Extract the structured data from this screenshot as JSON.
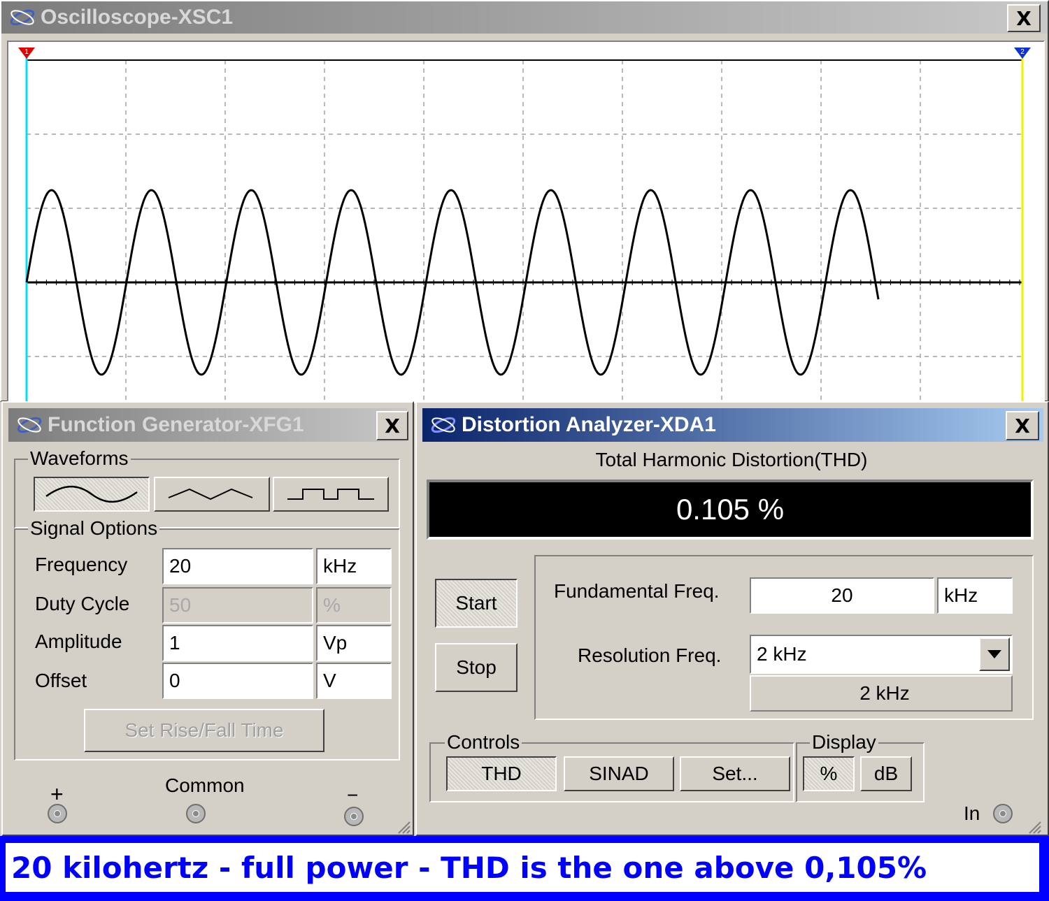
{
  "oscilloscope": {
    "title": "Oscilloscope-XSC1",
    "close_label": "X",
    "cursor1_label": "1",
    "cursor2_label": "2",
    "colors": {
      "trace": "#000000",
      "cursor1": "#00e0f0",
      "cursor2": "#f0f000",
      "grid": "#a0a0a0"
    }
  },
  "function_generator": {
    "title": "Function Generator-XFG1",
    "close_label": "X",
    "waveforms_legend": "Waveforms",
    "waveform_buttons": [
      {
        "name": "sine-wave-icon",
        "selected": true
      },
      {
        "name": "triangle-wave-icon",
        "selected": false
      },
      {
        "name": "square-wave-icon",
        "selected": false
      }
    ],
    "signal_options_legend": "Signal Options",
    "frequency": {
      "label": "Frequency",
      "value": "20",
      "unit": "kHz"
    },
    "duty_cycle": {
      "label": "Duty Cycle",
      "value": "50",
      "unit": "%"
    },
    "amplitude": {
      "label": "Amplitude",
      "value": "1",
      "unit": "Vp"
    },
    "offset": {
      "label": "Offset",
      "value": "0",
      "unit": "V"
    },
    "rise_fall_button": "Set Rise/Fall Time",
    "plus_label": "+",
    "common_label": "Common",
    "minus_label": "−"
  },
  "distortion_analyzer": {
    "title": "Distortion Analyzer-XDA1",
    "close_label": "X",
    "thd_heading": "Total Harmonic Distortion(THD)",
    "thd_value": "0.105 %",
    "start_button": "Start",
    "stop_button": "Stop",
    "fundamental_label": "Fundamental Freq.",
    "fundamental_value": "20",
    "fundamental_unit": "kHz",
    "resolution_label": "Resolution Freq.",
    "resolution_value": "2 kHz",
    "resolution_readout": "2 kHz",
    "controls_legend": "Controls",
    "controls_buttons": [
      "THD",
      "SINAD",
      "Set..."
    ],
    "display_legend": "Display",
    "display_buttons": [
      "%",
      "dB"
    ],
    "in_label": "In"
  },
  "caption": {
    "text": "20 kilohertz - full power - THD is the one above 0,105%",
    "color": "#0000ff"
  }
}
